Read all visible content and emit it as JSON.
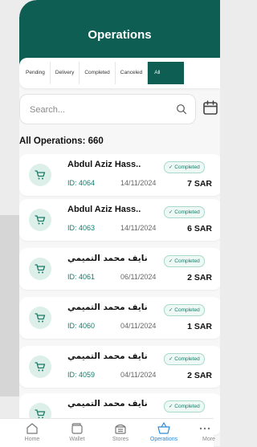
{
  "header": {
    "title": "Operations"
  },
  "tabs": [
    {
      "label": "Pending",
      "active": false
    },
    {
      "label": "Delivery",
      "active": false
    },
    {
      "label": "Completed",
      "active": false
    },
    {
      "label": "Canceled",
      "active": false
    },
    {
      "label": "All",
      "active": true
    }
  ],
  "search": {
    "placeholder": "Search..."
  },
  "summary": {
    "all_operations": "All Operations: 660"
  },
  "operations": [
    {
      "name": "Abdul Aziz Hass..",
      "id": "ID: 4064",
      "date": "14/11/2024",
      "status": "Completed",
      "amount": "7 SAR"
    },
    {
      "name": "Abdul Aziz Hass..",
      "id": "ID: 4063",
      "date": "14/11/2024",
      "status": "Completed",
      "amount": "6 SAR"
    },
    {
      "name": "نايف محمد التميمي",
      "id": "ID: 4061",
      "date": "06/11/2024",
      "status": "Completed",
      "amount": "2 SAR"
    },
    {
      "name": "نايف محمد التميمي",
      "id": "ID: 4060",
      "date": "04/11/2024",
      "status": "Completed",
      "amount": "1 SAR"
    },
    {
      "name": "نايف محمد التميمي",
      "id": "ID: 4059",
      "date": "04/11/2024",
      "status": "Completed",
      "amount": "2 SAR"
    },
    {
      "name": "نايف محمد التميمي",
      "id": "",
      "date": "",
      "status": "Completed",
      "amount": ""
    }
  ],
  "bottom_nav": [
    {
      "label": "Home",
      "icon": "home-icon",
      "active": false
    },
    {
      "label": "Wallet",
      "icon": "wallet-icon",
      "active": false
    },
    {
      "label": "Stores",
      "icon": "store-icon",
      "active": false
    },
    {
      "label": "Operations",
      "icon": "basket-icon",
      "active": true
    },
    {
      "label": "More",
      "icon": "more-icon",
      "active": false
    }
  ],
  "colors": {
    "primary": "#0e5e54",
    "accent": "#2a8ad8",
    "status_completed": "#1a7a66"
  }
}
